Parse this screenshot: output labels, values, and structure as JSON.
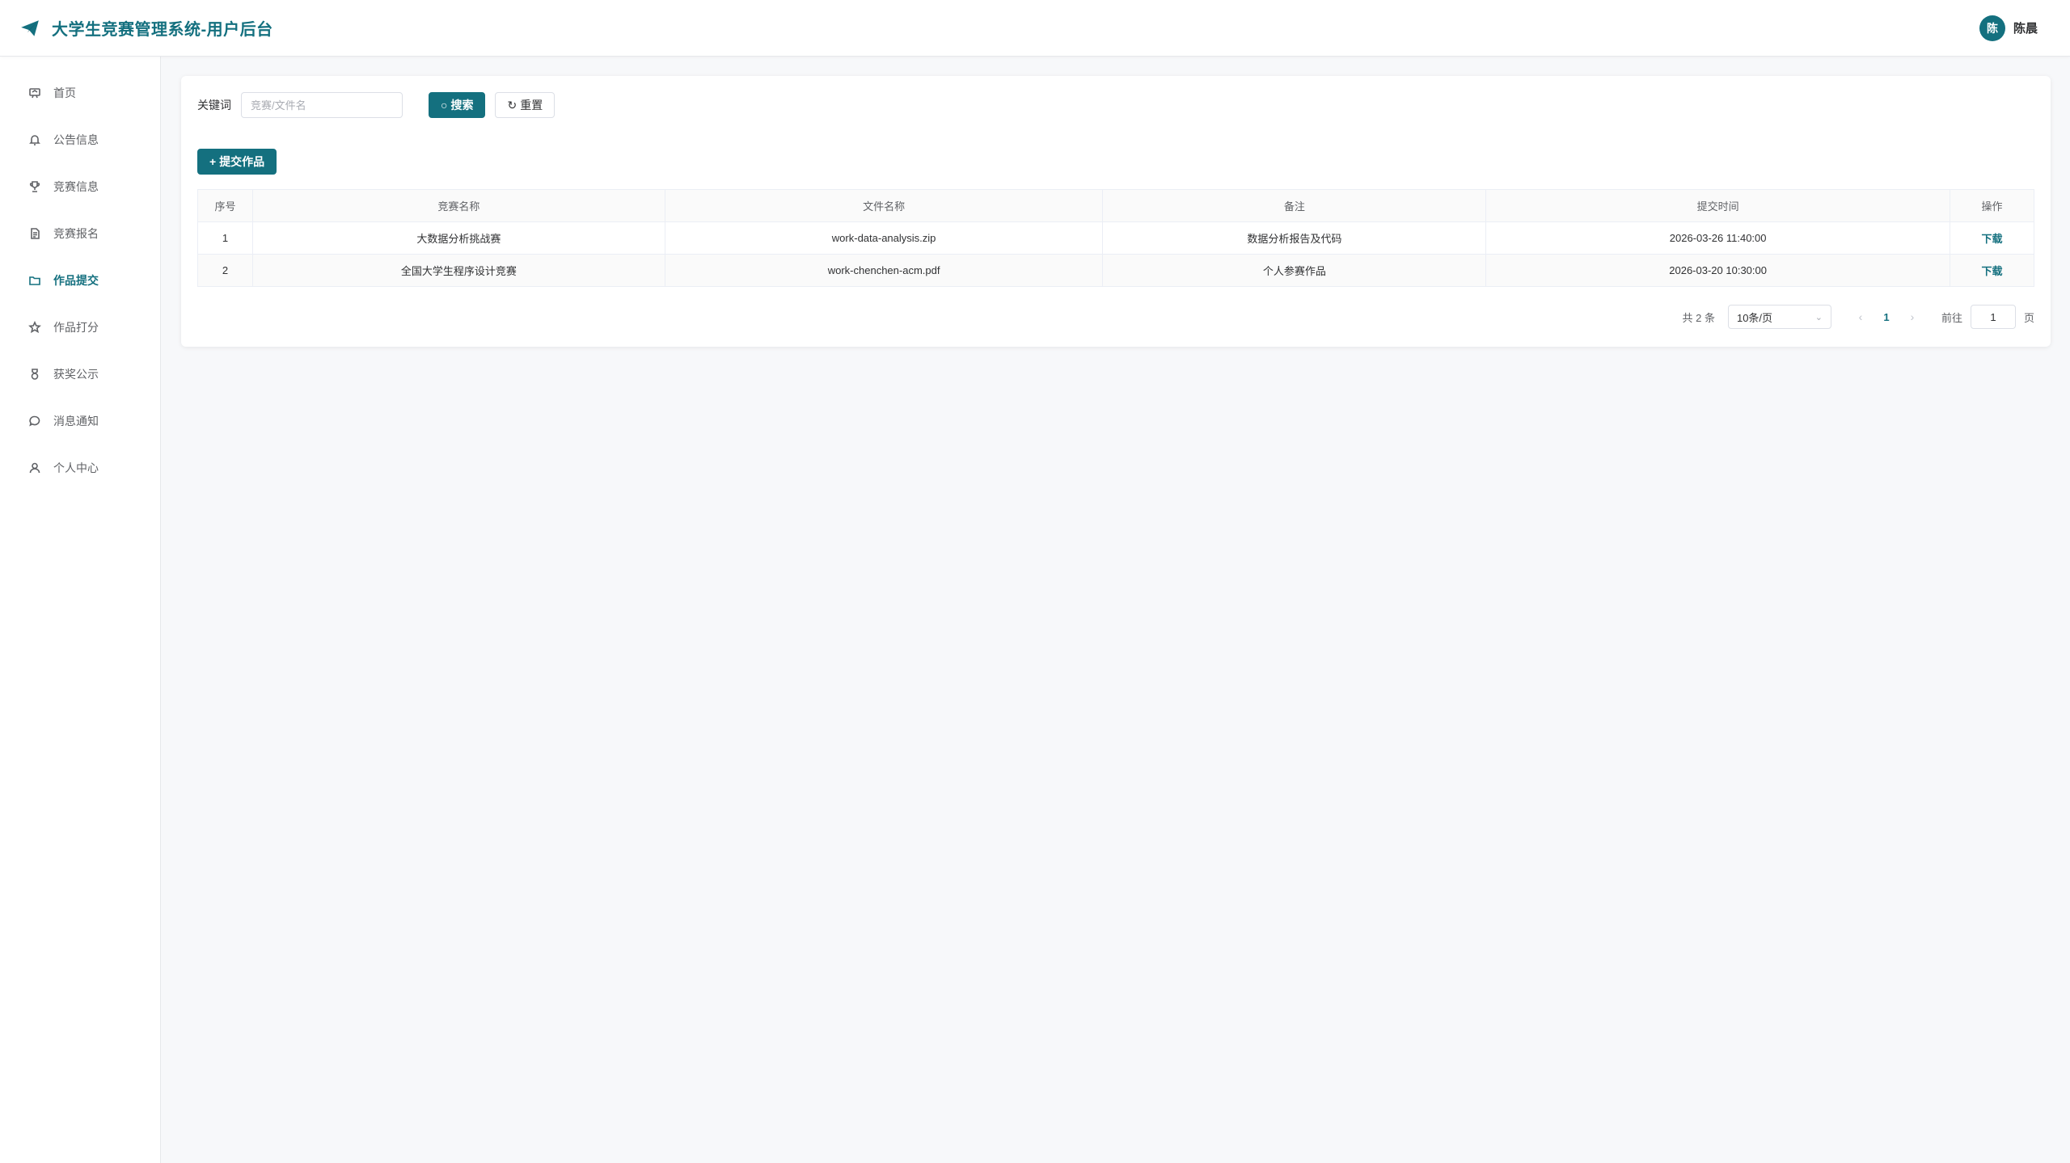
{
  "header": {
    "title": "大学生竞赛管理系统-用户后台",
    "user_avatar": "陈",
    "user_name": "陈晨"
  },
  "sidebar": {
    "items": [
      {
        "label": "首页",
        "icon": "home-icon"
      },
      {
        "label": "公告信息",
        "icon": "bell-icon"
      },
      {
        "label": "竞赛信息",
        "icon": "trophy-icon"
      },
      {
        "label": "竞赛报名",
        "icon": "document-icon"
      },
      {
        "label": "作品提交",
        "icon": "folder-icon",
        "active": true
      },
      {
        "label": "作品打分",
        "icon": "star-icon"
      },
      {
        "label": "获奖公示",
        "icon": "medal-icon"
      },
      {
        "label": "消息通知",
        "icon": "chat-icon"
      },
      {
        "label": "个人中心",
        "icon": "user-icon"
      }
    ]
  },
  "search": {
    "label": "关键词",
    "placeholder": "竞赛/文件名",
    "search_button": "搜索",
    "reset_button": "重置"
  },
  "toolbar": {
    "submit_button": "提交作品"
  },
  "table": {
    "columns": [
      "序号",
      "竞赛名称",
      "文件名称",
      "备注",
      "提交时间",
      "操作"
    ],
    "rows": [
      {
        "index": "1",
        "competition": "大数据分析挑战赛",
        "file": "work-data-analysis.zip",
        "remark": "数据分析报告及代码",
        "time": "2026-03-26 11:40:00",
        "action": "下载"
      },
      {
        "index": "2",
        "competition": "全国大学生程序设计竞赛",
        "file": "work-chenchen-acm.pdf",
        "remark": "个人参赛作品",
        "time": "2026-03-20 10:30:00",
        "action": "下载"
      }
    ]
  },
  "pagination": {
    "total": "共 2 条",
    "page_size": "10条/页",
    "current_page": "1",
    "goto_label": "前往",
    "goto_value": "1",
    "unit": "页"
  },
  "colors": {
    "accent": "#14707f",
    "background": "#f7f8fa"
  }
}
